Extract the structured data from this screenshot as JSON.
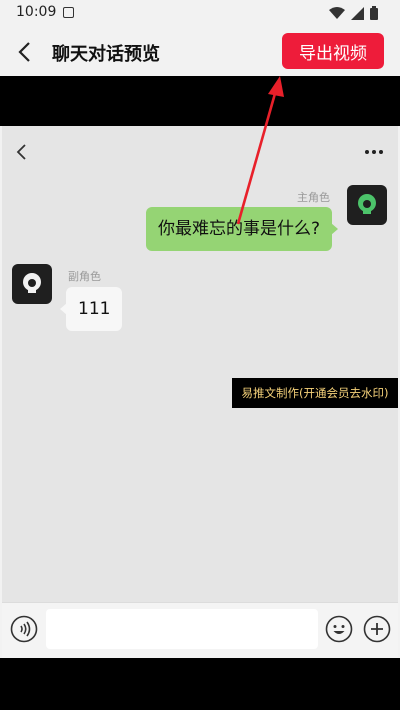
{
  "status_bar": {
    "time": "10:09"
  },
  "app_bar": {
    "title": "聊天对话预览",
    "export_label": "导出视频"
  },
  "chat": {
    "main_role": {
      "name": "主角色",
      "message": "你最难忘的事是什么?"
    },
    "side_role": {
      "name": "副角色",
      "message": "111"
    },
    "watermark": "易推文制作(开通会员去水印)"
  },
  "input_bar": {
    "placeholder": ""
  },
  "colors": {
    "accent": "#ee1c3a",
    "bubble_green": "#95d474",
    "arrow": "#e8202a"
  }
}
